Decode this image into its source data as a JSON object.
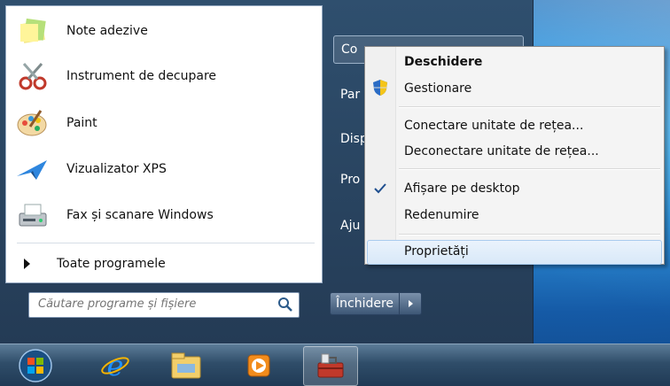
{
  "programs": [
    {
      "label": "Note adezive",
      "icon": "sticky-notes-icon"
    },
    {
      "label": "Instrument de decupare",
      "icon": "scissors-icon"
    },
    {
      "label": "Paint",
      "icon": "paint-palette-icon"
    },
    {
      "label": "Vizualizator XPS",
      "icon": "xps-viewer-icon"
    },
    {
      "label": "Fax și scanare Windows",
      "icon": "fax-scanner-icon"
    }
  ],
  "all_programs": "Toate programele",
  "search": {
    "placeholder": "Căutare programe și fișiere"
  },
  "right_pane": [
    "Co",
    "Par",
    "Disp",
    "Pro",
    "Aju"
  ],
  "shutdown": {
    "label": "Închidere"
  },
  "context_menu": {
    "open": "Deschidere",
    "manage": "Gestionare",
    "map_drive": "Conectare unitate de rețea...",
    "disconnect_drive": "Deconectare unitate de rețea...",
    "show_desktop": "Afișare pe desktop",
    "rename": "Redenumire",
    "properties": "Proprietăți"
  },
  "taskbar": [
    "start-orb-icon",
    "internet-explorer-icon",
    "windows-explorer-icon",
    "media-player-icon",
    "toolbox-icon"
  ]
}
